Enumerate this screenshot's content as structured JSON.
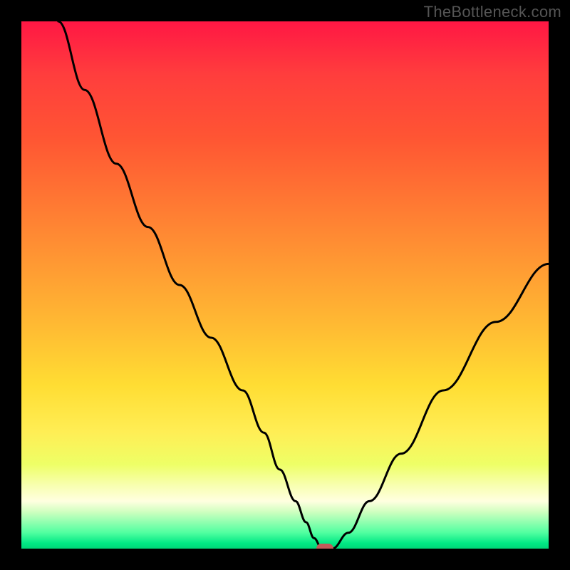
{
  "watermark": "TheBottleneck.com",
  "chart_data": {
    "type": "line",
    "title": "",
    "xlabel": "",
    "ylabel": "",
    "xlim": [
      0,
      100
    ],
    "ylim": [
      0,
      100
    ],
    "x": [
      7,
      12,
      18,
      24,
      30,
      36,
      42,
      46,
      49,
      52,
      54,
      55.5,
      57,
      59,
      62,
      66,
      72,
      80,
      90,
      100
    ],
    "y": [
      100,
      87,
      73,
      61,
      50,
      40,
      30,
      22,
      15,
      9,
      5,
      2,
      0,
      0,
      3,
      9,
      18,
      30,
      43,
      54
    ],
    "marker": {
      "x": 57.5,
      "y": 0
    },
    "grid": false,
    "legend": false
  },
  "colors": {
    "background": "#000000",
    "gradient_top": "#ff1744",
    "gradient_bottom": "#00d577",
    "curve": "#000000",
    "marker": "#c25a5a",
    "watermark": "#555555"
  }
}
